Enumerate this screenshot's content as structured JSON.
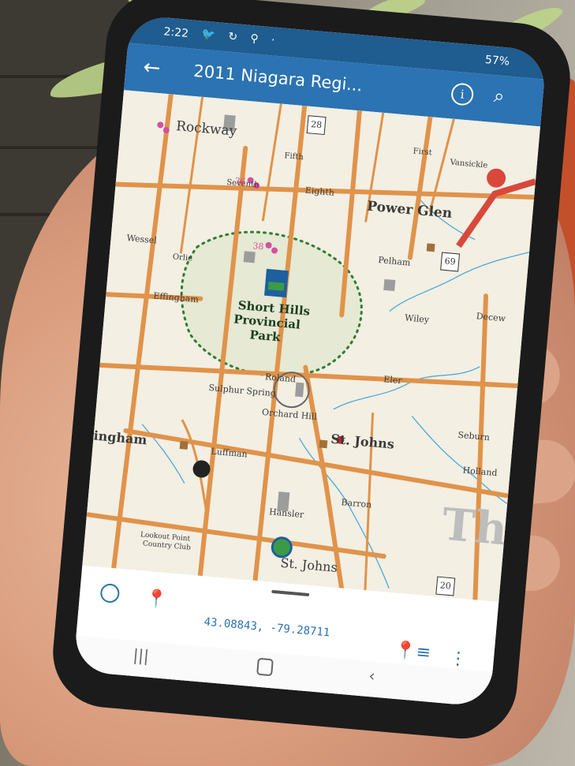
{
  "status": {
    "time": "2:22",
    "icons": "🐦 ↻ ⚲ ·",
    "battery": "57%"
  },
  "appbar": {
    "title": "2011 Niagara Regi...",
    "back_icon": "arrow-left-icon",
    "info_icon": "info-icon",
    "search_icon": "search-icon"
  },
  "map": {
    "labels": {
      "rockway": "Rockway",
      "power_glen": "Power Glen",
      "short_hills": "Short Hills",
      "provincial": "Provincial",
      "park": "Park",
      "st_johns": "St. Johns",
      "st_johns_2": "St. Johns",
      "ingham": "ingham",
      "eighth": "Eighth",
      "pelham": "Pelham",
      "effingham": "Effingham",
      "wessel": "Wessel",
      "orchard_hill": "Orchard Hill",
      "sulphur_spring": "Sulphur Spring",
      "roland": "Roland",
      "luffman": "Luffman",
      "barron": "Barron",
      "hansler": "Hansler",
      "holland": "Holland",
      "seburn": "Seburn",
      "wiley": "Wiley",
      "decew": "Decew",
      "eler": "Eler",
      "lookout_point": "Lookout Point",
      "country_club": "Country Club",
      "first": "First",
      "vansickle": "Vansickle",
      "fifth": "Fifth",
      "seventh": "Seventh",
      "orlie": "Orlie",
      "highway_28": "28",
      "highway_69": "69",
      "highway_20": "20",
      "num_36": "36",
      "num_38": "38",
      "th": "Th"
    }
  },
  "sheet": {
    "coordinates": "43.08843, -79.28711"
  },
  "colors": {
    "app_bar": "#2b73b2",
    "status_bar": "#1f5c8f",
    "road": "#e0934a",
    "park_trail": "#2e7d32",
    "water": "#4ea9d8"
  }
}
